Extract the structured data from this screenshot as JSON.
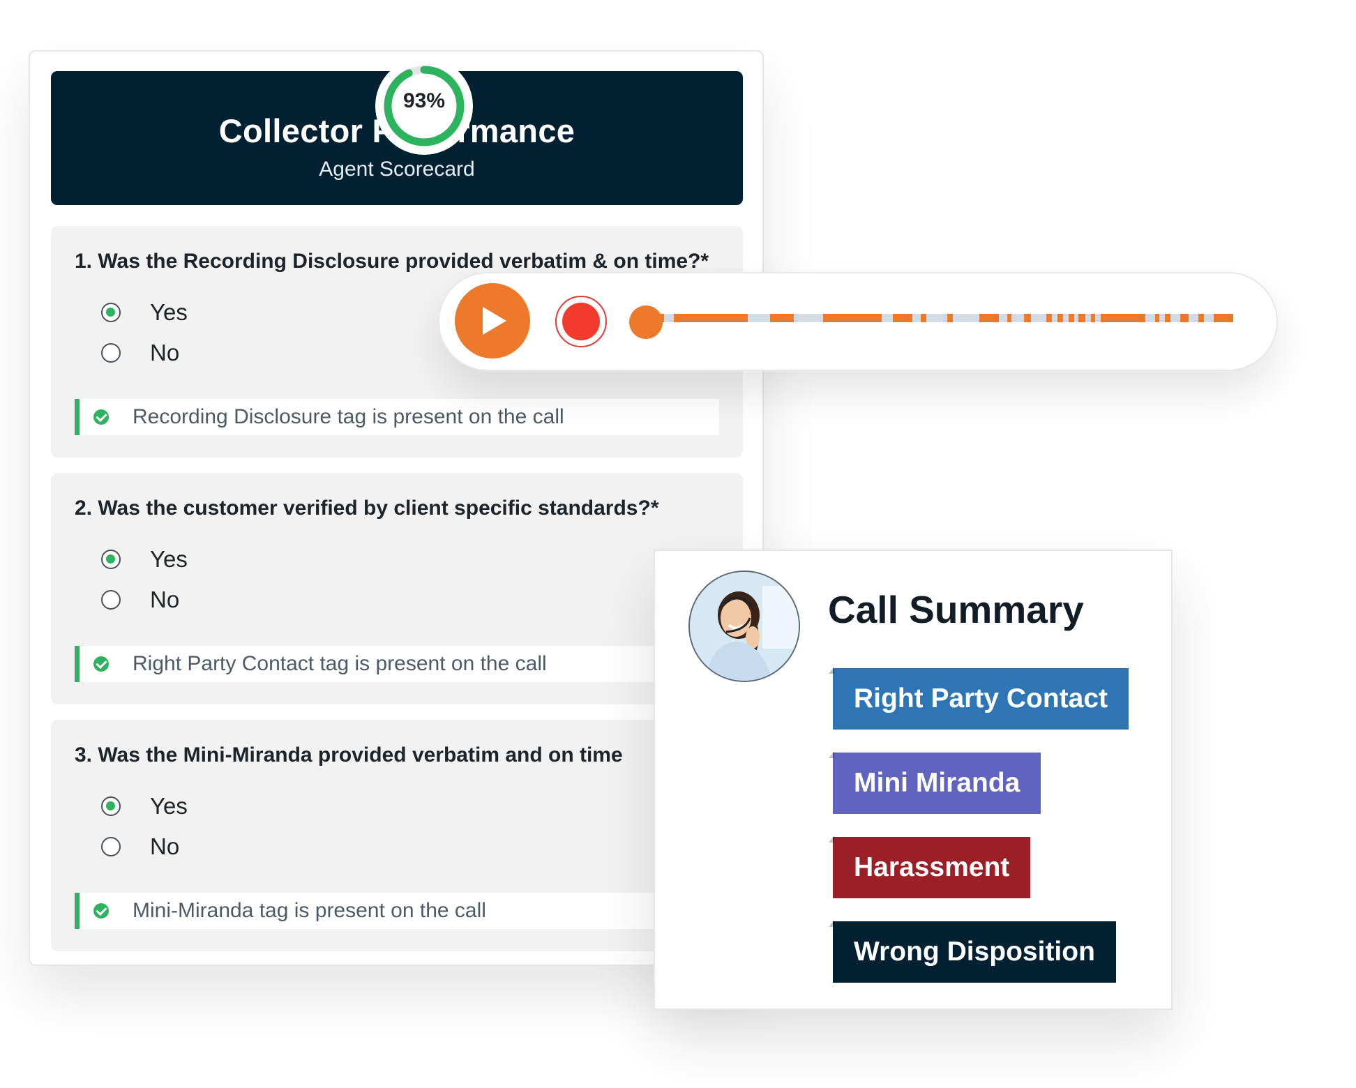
{
  "scorecard": {
    "score": "93%",
    "score_fraction": 0.93,
    "title": "Collector Performance",
    "subtitle": "Agent Scorecard",
    "questions": [
      {
        "text": "1. Was the Recording Disclosure provided verbatim & on time?*",
        "options": [
          "Yes",
          "No"
        ],
        "selected": "Yes",
        "tag_note": "Recording Disclosure tag is present on the call"
      },
      {
        "text": "2. Was the customer verified by client specific standards?*",
        "options": [
          "Yes",
          "No"
        ],
        "selected": "Yes",
        "tag_note": "Right Party Contact tag is present on the call"
      },
      {
        "text": "3. Was the Mini-Miranda provided verbatim and on time",
        "options": [
          "Yes",
          "No"
        ],
        "selected": "Yes",
        "tag_note": "Mini-Miranda tag is present on the call"
      }
    ]
  },
  "player": {
    "play_icon": "play-icon",
    "record_icon": "record-icon",
    "progress": 0.0
  },
  "summary": {
    "title": "Call Summary",
    "avatar_icon": "agent-avatar",
    "tags": [
      {
        "label": "Right Party Contact",
        "color": "#2e75b6"
      },
      {
        "label": "Mini Miranda",
        "color": "#6163c0"
      },
      {
        "label": "Harassment",
        "color": "#9b1f27"
      },
      {
        "label": "Wrong Disposition",
        "color": "#012031"
      }
    ]
  },
  "colors": {
    "accent_orange": "#ec7a2a",
    "success_green": "#2db35d",
    "header_navy": "#012031"
  }
}
